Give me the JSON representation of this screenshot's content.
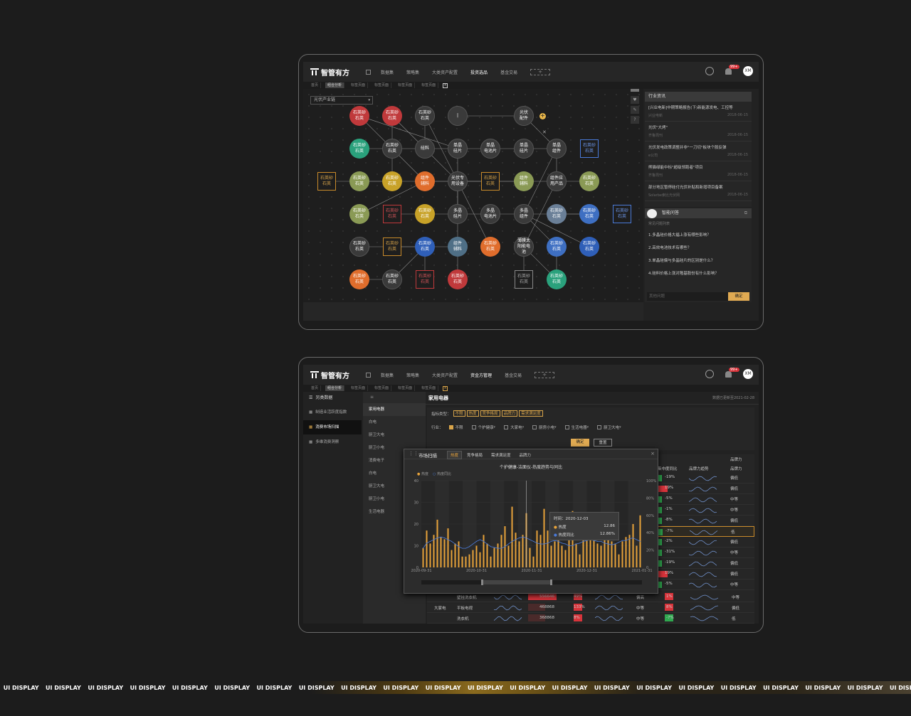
{
  "logo_text": "智管有方",
  "top_nav_1": [
    "数据集",
    "策略集",
    "大类资产配置",
    "投资选品",
    "基金交易"
  ],
  "top_nav_2": [
    "数据集",
    "策略集",
    "大类资产配置",
    "资金方管理",
    "基金交易"
  ],
  "nav_plus": "+",
  "badge": "99+",
  "avatar": "XM",
  "tabs": [
    "首页",
    "组合分析",
    "标签页面",
    "标签页面",
    "标签页面",
    "标签页面"
  ],
  "tab_close": "×",
  "graph": {
    "select_value": "光伏产业链",
    "nodes": [
      {
        "label": "石英砂\n石英",
        "color": "#c0393b",
        "style": "circle"
      },
      {
        "label": "石英砂\n石英",
        "color": "#c0393b",
        "style": "circle"
      },
      {
        "label": "石英砂\n石英",
        "color": "#3a3a3a",
        "style": "circle"
      },
      {
        "label": "|",
        "color": "#3a3a3a",
        "style": "circle"
      },
      {
        "label": "光伏\n配件",
        "color": "#3a3a3a",
        "style": "circle"
      },
      {
        "label": "石英砂\n石英",
        "color": "#2aa17c",
        "style": "circle"
      },
      {
        "label": "石英砂\n石英",
        "color": "#3a3a3a",
        "style": "circle"
      },
      {
        "label": "硅料",
        "color": "#3a3a3a",
        "style": "circle"
      },
      {
        "label": "单晶\n硅片",
        "color": "#3a3a3a",
        "style": "circle"
      },
      {
        "label": "单晶\n电池片",
        "color": "#3a3a3a",
        "style": "circle"
      },
      {
        "label": "单晶\n硅片",
        "color": "#3a3a3a",
        "style": "circle"
      },
      {
        "label": "单晶\n组件",
        "color": "#3a3a3a",
        "style": "circle"
      },
      {
        "label": "石英砂\n石英",
        "color": "#4a7ad8",
        "style": "box-blue"
      },
      {
        "label": "石英砂\n石英",
        "color": "#c88a2a",
        "style": "box"
      },
      {
        "label": "石英砂\n石英",
        "color": "#8a9a55",
        "style": "circle"
      },
      {
        "label": "石英砂\n石英",
        "color": "#c8a228",
        "style": "circle"
      },
      {
        "label": "组件\n辅料",
        "color": "#e06d2c",
        "style": "circle"
      },
      {
        "label": "光伏专\n用设备",
        "color": "#3a3a3a",
        "style": "circle"
      },
      {
        "label": "石英砂\n石英",
        "color": "#c88a2a",
        "style": "box"
      },
      {
        "label": "组件\n辅料",
        "color": "#8a9a55",
        "style": "circle"
      },
      {
        "label": "组件应\n用产品",
        "color": "#3a3a3a",
        "style": "circle"
      },
      {
        "label": "石英砂\n石英",
        "color": "#8a9a55",
        "style": "circle"
      },
      {
        "label": "石英砂\n石英",
        "color": "#8a9a55",
        "style": "circle"
      },
      {
        "label": "石英砂\n石英",
        "color": "#c0393b",
        "style": "box-red"
      },
      {
        "label": "石英砂\n石英",
        "color": "#c8a228",
        "style": "circle"
      },
      {
        "label": "多晶\n硅片",
        "color": "#3a3a3a",
        "style": "circle"
      },
      {
        "label": "多晶\n电池片",
        "color": "#3a3a3a",
        "style": "circle"
      },
      {
        "label": "多晶\n组件",
        "color": "#3a3a3a",
        "style": "circle"
      },
      {
        "label": "石英砂\n石英",
        "color": "#6a7f97",
        "style": "circle"
      },
      {
        "label": "石英砂\n石英",
        "color": "#3e6fc2",
        "style": "circle"
      },
      {
        "label": "石英砂\n石英",
        "color": "#4a7ad8",
        "style": "box-blue"
      },
      {
        "label": "石英砂\n石英",
        "color": "#3a3a3a",
        "style": "circle"
      },
      {
        "label": "石英砂\n石英",
        "color": "#c88a2a",
        "style": "box"
      },
      {
        "label": "石英砂\n石英",
        "color": "#2f5fb8",
        "style": "circle"
      },
      {
        "label": "组件\n辅料",
        "color": "#4f6f86",
        "style": "circle"
      },
      {
        "label": "石英砂\n石英",
        "color": "#e06d2c",
        "style": "circle"
      },
      {
        "label": "薄膜太\n阳能电\n池",
        "color": "#3a3a3a",
        "style": "circle"
      },
      {
        "label": "石英砂\n石英",
        "color": "#3e6fc2",
        "style": "circle"
      },
      {
        "label": "石英砂\n石英",
        "color": "#2f5fb8",
        "style": "circle"
      },
      {
        "label": "石英砂\n石英",
        "color": "#e06d2c",
        "style": "circle"
      },
      {
        "label": "石英砂\n石英",
        "color": "#3a3a3a",
        "style": "circle"
      },
      {
        "label": "石英砂\n石英",
        "color": "#c88a2a",
        "style": "box-red"
      },
      {
        "label": "石英砂\n石英",
        "color": "#c0393b",
        "style": "circle"
      },
      {
        "label": "石英砂\n石英",
        "color": "#888888",
        "style": "box-gray"
      },
      {
        "label": "石英砂\n石英",
        "color": "#2aa17c",
        "style": "circle"
      }
    ],
    "side_icons": [
      "heart-icon",
      "edit-icon",
      "help-icon"
    ]
  },
  "news_panel": {
    "title": "行业资讯",
    "items": [
      {
        "title": "[兴业电新]中期策略报告(下)新能源发电、工控等",
        "source": "兴业电新",
        "date": "2018-06-15"
      },
      {
        "title": "光伏\"大烤\"",
        "source": "齐鲁周刊",
        "date": "2018-06-15"
      },
      {
        "title": "光伏发电政策调整并非\"一刀切\"板块个股反弹",
        "source": "e公司",
        "date": "2018-06-15"
      },
      {
        "title": "熊猫绿能中标\"超级领跑者\"项目",
        "source": "齐鲁周刊",
        "date": "2018-06-15"
      },
      {
        "title": "部分地区暂停硅付光伏补贴和新增项目备案",
        "source": "Solarbe索比光伏网",
        "date": "2018-06-15"
      }
    ]
  },
  "qa_panel": {
    "title": "智能问答",
    "subtitle": "常见问题列表",
    "questions": [
      "1.多晶硅价格大福上涨有哪些影响？",
      "2.高效电池技术有哪些？",
      "3.单晶硅偏与多晶硅片的区别是什么？",
      "4.硅料价格上涨对隆基股份有什么影响？"
    ],
    "input_placeholder": "其他问题",
    "confirm": "确定"
  },
  "dash": {
    "left_menu_title": "另类数据",
    "left_menu": [
      "制造业活跃度指数",
      "消费市场扫描",
      "多维消费洞察"
    ],
    "category_list": [
      "家用电器",
      "白电",
      "厨卫大电",
      "厨卫小电",
      "消费电子",
      "白电",
      "厨卫大电",
      "厨卫小电",
      "生活电器"
    ],
    "page_title": "家用电器",
    "updated": "数据已更新至2021-02-28",
    "indicator_label": "指标类型：",
    "indicator_chips": [
      "不限",
      "热度",
      "竞争格局",
      "品牌力",
      "需求满足度"
    ],
    "industry_label": "行业：",
    "industry_opts": [
      {
        "label": "不限",
        "on": true
      },
      {
        "label": "个护健康",
        "on": false
      },
      {
        "label": "大家电",
        "on": false
      },
      {
        "label": "厨房小电",
        "on": false
      },
      {
        "label": "生活电器",
        "on": false
      },
      {
        "label": "厨卫大电",
        "on": false
      }
    ],
    "btn_ok": "确定",
    "btn_reset": "重置",
    "table_header_group": "品牌力",
    "table_headers": [
      "集中度同比",
      "品牌力趋势",
      "品牌力"
    ],
    "rows": [
      {
        "pct": "-19%",
        "level": "偏低"
      },
      {
        "pct": "19%",
        "level": "偏低"
      },
      {
        "pct": "-5%",
        "level": "中等"
      },
      {
        "pct": "-1%",
        "level": "中等"
      },
      {
        "pct": "-8%",
        "level": "偏低"
      },
      {
        "pct": "-7%",
        "level": "低"
      },
      {
        "pct": "-2%",
        "level": "偏低"
      },
      {
        "pct": "-31%",
        "level": "中等"
      },
      {
        "pct": "-19%",
        "level": "偏低"
      },
      {
        "pct": "19%",
        "level": "偏低"
      },
      {
        "pct": "-5%",
        "level": "中等"
      }
    ],
    "bottom_rows": [
      {
        "group": "",
        "name": "壁挂洗衣机",
        "value": "556646",
        "pct1": "49%",
        "level1": "偏高",
        "pct2": "1%",
        "level2": "中等"
      },
      {
        "group": "大家电",
        "name": "平板电视",
        "value": "468868",
        "pct1": "133%",
        "level1": "中等",
        "pct2": "8%",
        "level2": "偏低"
      },
      {
        "group": "",
        "name": "洗衣机",
        "value": "368868",
        "pct1": "8%",
        "level1": "中等",
        "pct2": "-7%",
        "level2": "低"
      }
    ]
  },
  "modal": {
    "title": "市场扫描",
    "tabs": [
      "热度",
      "竞争格局",
      "需求满足度",
      "品牌力"
    ],
    "close": "×",
    "chart_title": "个护健康-洁面仪-热度趋势与同比",
    "legend": [
      "热度",
      "热度同比"
    ],
    "tooltip": {
      "time_label": "时间：2020-12-03",
      "rows": [
        {
          "name": "热度",
          "value": "12.86"
        },
        {
          "name": "热度同比",
          "value": "12.86%"
        }
      ]
    }
  },
  "chart_data": {
    "type": "bar",
    "title": "个护健康-洁面仪-热度趋势与同比",
    "x_tick_labels": [
      "2020-09-31",
      "2020-10-31",
      "2020-11-31",
      "2020-12-31",
      "2021-01-31"
    ],
    "y_left_ticks": [
      "0",
      "10",
      "20",
      "30",
      "40"
    ],
    "y_right_ticks": [
      "0",
      "20%",
      "40%",
      "60%",
      "80%",
      "100%"
    ],
    "ylim": [
      0,
      40
    ],
    "y2lim": [
      0,
      100
    ],
    "series": [
      {
        "name": "热度",
        "type": "bar",
        "color": "#e8a33a",
        "values": [
          9,
          17,
          11,
          15,
          22,
          14,
          13,
          18,
          8,
          11,
          12,
          5,
          5,
          6,
          8,
          10,
          7,
          15,
          11,
          5,
          9,
          11,
          15,
          19,
          10,
          28,
          16,
          12,
          15,
          25,
          9,
          5,
          17,
          15,
          27,
          17,
          10,
          12,
          16,
          10,
          8,
          15,
          26,
          11,
          6,
          20,
          20,
          14,
          18,
          11,
          10,
          15,
          14,
          12,
          11,
          6,
          12,
          14,
          15,
          20,
          10,
          24
        ]
      },
      {
        "name": "热度同比",
        "type": "line",
        "color": "#4a7ad8",
        "values": [
          22,
          28,
          30,
          32,
          34,
          35,
          34,
          32,
          30,
          27,
          24,
          22,
          22,
          24,
          27,
          30,
          32,
          30,
          27,
          24,
          23,
          22,
          22,
          24,
          27,
          30,
          32,
          34,
          35,
          34,
          32,
          30,
          28,
          27,
          27,
          28,
          30,
          31,
          30,
          28,
          27,
          25,
          25,
          27,
          28,
          30,
          31,
          32,
          31,
          30,
          30,
          28,
          27,
          26,
          27,
          29,
          31,
          31,
          33,
          34,
          32,
          30
        ]
      }
    ],
    "tooltip_x": "2020-12-03"
  },
  "ticker_text": "UI DISPLAY",
  "ticker_count": 22
}
